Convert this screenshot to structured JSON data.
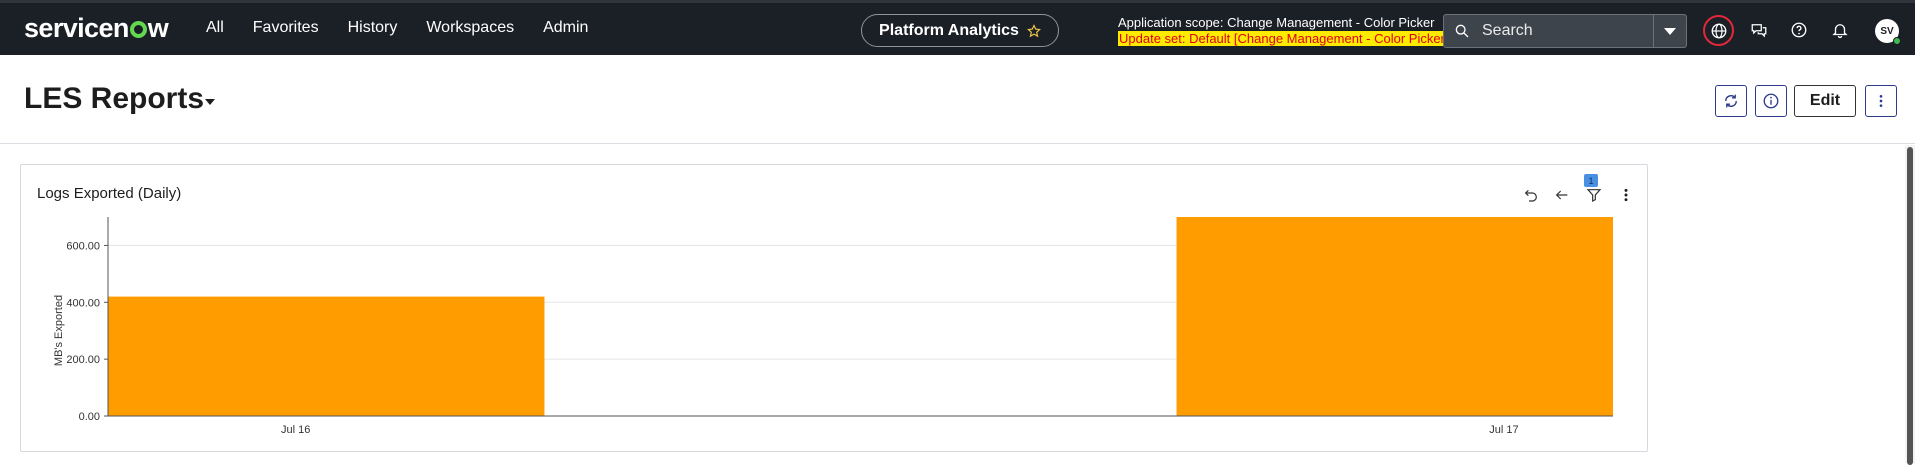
{
  "nav": {
    "logo": "servicenow",
    "menu": [
      "All",
      "Favorites",
      "History",
      "Workspaces",
      "Admin"
    ],
    "app_pill": "Platform Analytics",
    "scope_line": "Application scope: Change Management - Color Picker",
    "update_line": "Update set: Default [Change Management - Color Picker]",
    "search_placeholder": "Search",
    "avatar_initials": "SV"
  },
  "header": {
    "title": "LES Reports",
    "edit_label": "Edit"
  },
  "report": {
    "title": "Logs Exported (Daily)",
    "filter_count": "1"
  },
  "colors": {
    "bar": "#ff9c00",
    "nav_bg": "#1b1f26",
    "accent_button": "#2d3a8c"
  },
  "chart_data": {
    "type": "bar",
    "categories": [
      "Jul 16",
      "Jul 17"
    ],
    "values": [
      420,
      700
    ],
    "ylabel": "MB's Exported",
    "ylim": [
      0,
      700
    ],
    "yticks": [
      "0.00",
      "200.00",
      "400.00",
      "600.00"
    ],
    "grid": true,
    "legend": "none"
  }
}
